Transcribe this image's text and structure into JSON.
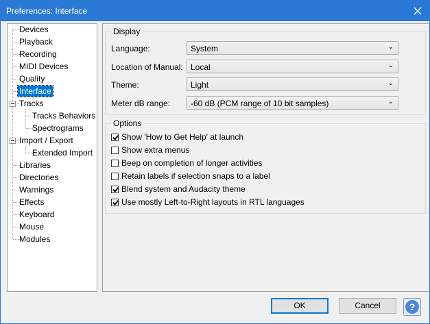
{
  "window": {
    "title": "Preferences: Interface",
    "close_icon": "close-icon",
    "title_color": "#2b79d7"
  },
  "tree": {
    "items": [
      {
        "label": "Devices"
      },
      {
        "label": "Playback"
      },
      {
        "label": "Recording"
      },
      {
        "label": "MIDI Devices"
      },
      {
        "label": "Quality"
      },
      {
        "label": "Interface",
        "selected": true
      },
      {
        "label": "Tracks",
        "expandable": true
      },
      {
        "label": "Tracks Behaviors"
      },
      {
        "label": "Spectrograms"
      },
      {
        "label": "Import / Export",
        "expandable": true
      },
      {
        "label": "Extended Import"
      },
      {
        "label": "Libraries"
      },
      {
        "label": "Directories"
      },
      {
        "label": "Warnings"
      },
      {
        "label": "Effects"
      },
      {
        "label": "Keyboard"
      },
      {
        "label": "Mouse"
      },
      {
        "label": "Modules"
      }
    ]
  },
  "display": {
    "title": "Display",
    "language": {
      "label": "Language:",
      "value": "System"
    },
    "manual": {
      "label": "Location of Manual:",
      "value": "Local"
    },
    "theme": {
      "label": "Theme:",
      "value": "Light"
    },
    "meter": {
      "label": "Meter dB range:",
      "value": "-60 dB (PCM range of 10 bit samples)"
    }
  },
  "options": {
    "title": "Options",
    "items": [
      {
        "label": "Show 'How to Get Help' at launch",
        "checked": true
      },
      {
        "label": "Show extra menus",
        "checked": false
      },
      {
        "label": "Beep on completion of longer activities",
        "checked": false
      },
      {
        "label": "Retain labels if selection snaps to a label",
        "checked": false
      },
      {
        "label": "Blend system and Audacity theme",
        "checked": true
      },
      {
        "label": "Use mostly Left-to-Right layouts in RTL languages",
        "checked": true
      }
    ]
  },
  "buttons": {
    "ok": "OK",
    "cancel": "Cancel",
    "help": "?"
  }
}
